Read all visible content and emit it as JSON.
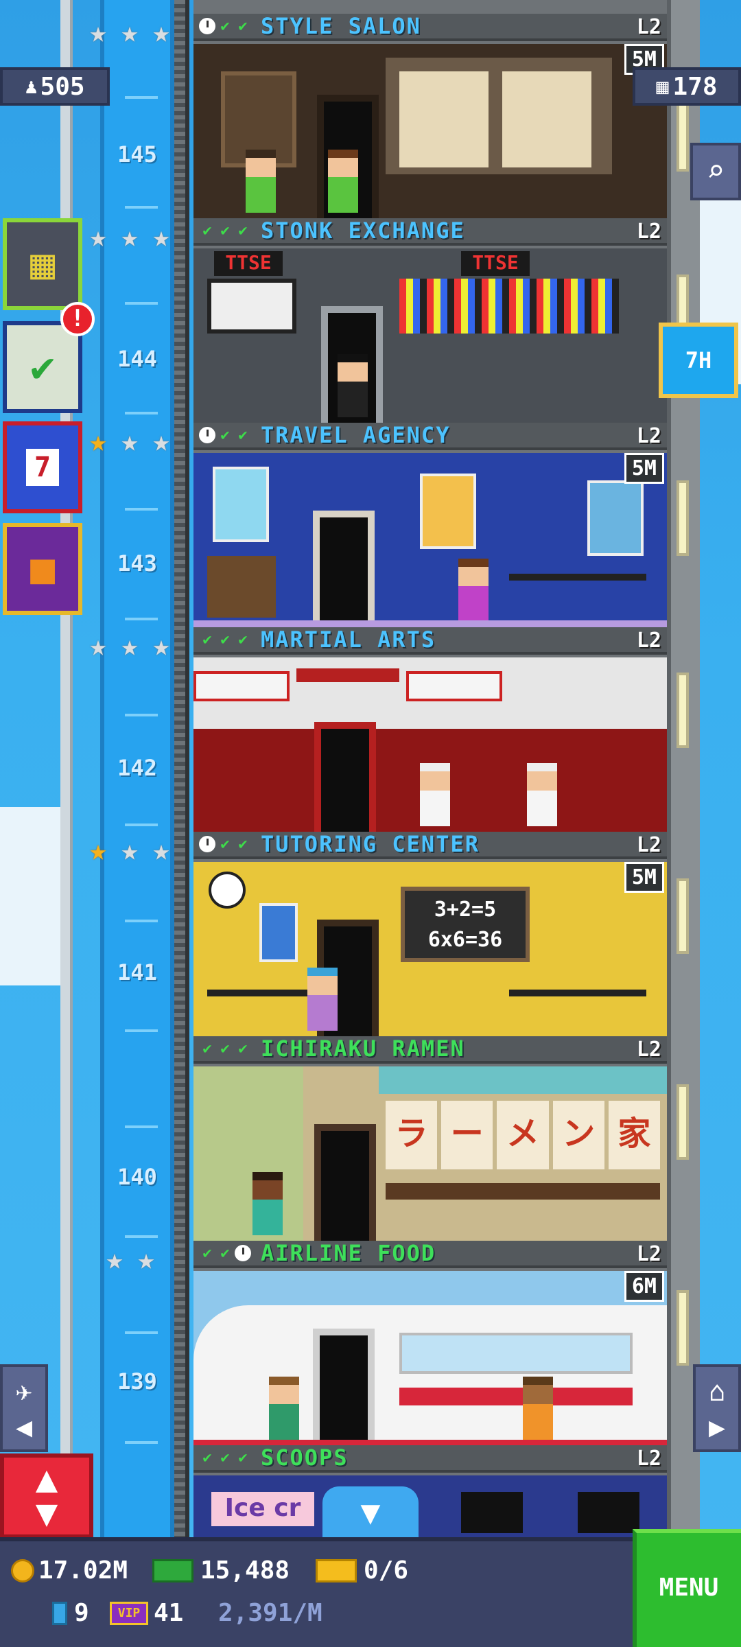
{
  "hud": {
    "population": "505",
    "right_counter": "178",
    "timer_button": "7H",
    "alert_badge": "!",
    "calendar_day": "7"
  },
  "shaft_floors": [
    "145",
    "144",
    "143",
    "142",
    "141",
    "140",
    "139"
  ],
  "floors": [
    {
      "name": "STYLE SALON",
      "level": "L2",
      "timer": "5M",
      "name_color": "#4cc3ff"
    },
    {
      "name": "STONK EXCHANGE",
      "level": "L2",
      "timer": "",
      "name_color": "#4cc3ff",
      "signs": [
        "TTSE",
        "TTSE"
      ]
    },
    {
      "name": "TRAVEL AGENCY",
      "level": "L2",
      "timer": "5M",
      "name_color": "#4cc3ff"
    },
    {
      "name": "MARTIAL ARTS",
      "level": "L2",
      "timer": "",
      "name_color": "#4cc3ff"
    },
    {
      "name": "TUTORING CENTER",
      "level": "L2",
      "timer": "5M",
      "name_color": "#4cc3ff",
      "blackboard": [
        "3+2=5",
        "6x6=36"
      ]
    },
    {
      "name": "ICHIRAKU RAMEN",
      "level": "L2",
      "timer": "",
      "name_color": "#3ee05a",
      "banner": [
        "ラ",
        "ー",
        "メ",
        "ン",
        "家"
      ]
    },
    {
      "name": "AIRLINE FOOD",
      "level": "L2",
      "timer": "6M",
      "name_color": "#3ee05a"
    },
    {
      "name": "SCOOPS",
      "level": "L2",
      "timer": "",
      "name_color": "#3ee05a",
      "sign": "Ice cr"
    }
  ],
  "bottom_bar": {
    "coins": "17.02M",
    "cash": "15,488",
    "tickets": "0/6",
    "bux": "9",
    "vip": "41",
    "vip_label": "VIP",
    "rate": "2,391/M",
    "menu_label": "MENU"
  },
  "colors": {
    "sky": "#3ab0f0",
    "shaft": "#27a3ef",
    "menu_green": "#2dbd2f",
    "elevator_red": "#e8283a",
    "star_gold": "#f5b11c"
  }
}
